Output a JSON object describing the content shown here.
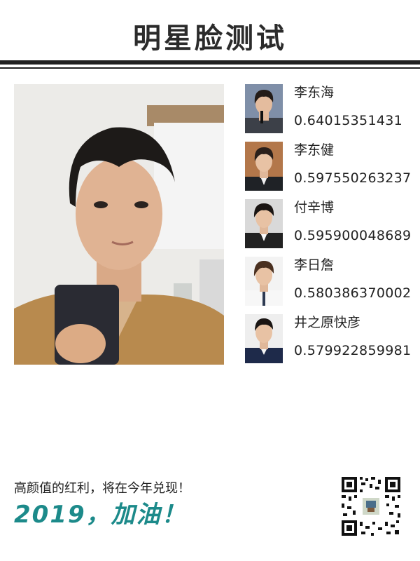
{
  "header": {
    "title": "明星脸测试"
  },
  "matches": [
    {
      "name": "李东海",
      "score": "0.64015351431"
    },
    {
      "name": "李东健",
      "score": "0.597550263237"
    },
    {
      "name": "付辛博",
      "score": "0.595900048689"
    },
    {
      "name": "李日詹",
      "score": "0.580386370002"
    },
    {
      "name": "井之原快彦",
      "score": "0.579922859981"
    }
  ],
  "footer": {
    "slogan": "高颜值的红利，将在今年兑现！",
    "cheer": "2019，加油！"
  },
  "colors": {
    "accent": "#1c8a8a",
    "rule": "#1f1f1f"
  }
}
